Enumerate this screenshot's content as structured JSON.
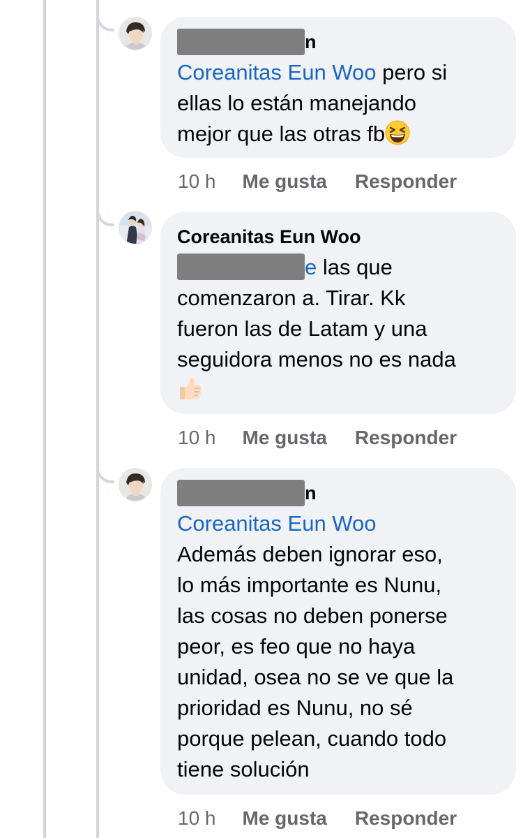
{
  "comments": [
    {
      "author_visible_suffix": "n",
      "mention": "Coreanitas Eun Woo",
      "text_line1": " pero si",
      "text_line2": "ellas lo están manejando",
      "text_line3": "mejor que las otras fb",
      "emoji": "grinning-squinting-face",
      "time": "10 h",
      "like_label": "Me gusta",
      "reply_label": "Responder"
    },
    {
      "author": "Coreanitas Eun Woo",
      "mention_visible_suffix": "e",
      "text_line1": " las que",
      "text_line2": "comenzaron a. Tirar. Kk",
      "text_line3": "fueron las de Latam y una",
      "text_line4": "seguidora menos no es nada",
      "emoji": "thumbs-up",
      "time": "10 h",
      "like_label": "Me gusta",
      "reply_label": "Responder"
    },
    {
      "author_visible_suffix": "n",
      "mention": "Coreanitas Eun Woo",
      "lines": [
        "Además deben ignorar eso,",
        "lo más importante es Nunu,",
        "las cosas no deben ponerse",
        "peor, es feo que no haya",
        "unidad, osea no se ve que la",
        "prioridad es Nunu, no sé",
        "porque pelean, cuando todo",
        "tiene solución"
      ],
      "time": "10 h",
      "like_label": "Me gusta",
      "reply_label": "Responder"
    }
  ],
  "colors": {
    "bubble_bg": "#f0f2f5",
    "mention": "#1a66c2",
    "meta_text": "#65676b",
    "thread_line": "#d3d6db",
    "redaction": "#7f7f7f"
  }
}
